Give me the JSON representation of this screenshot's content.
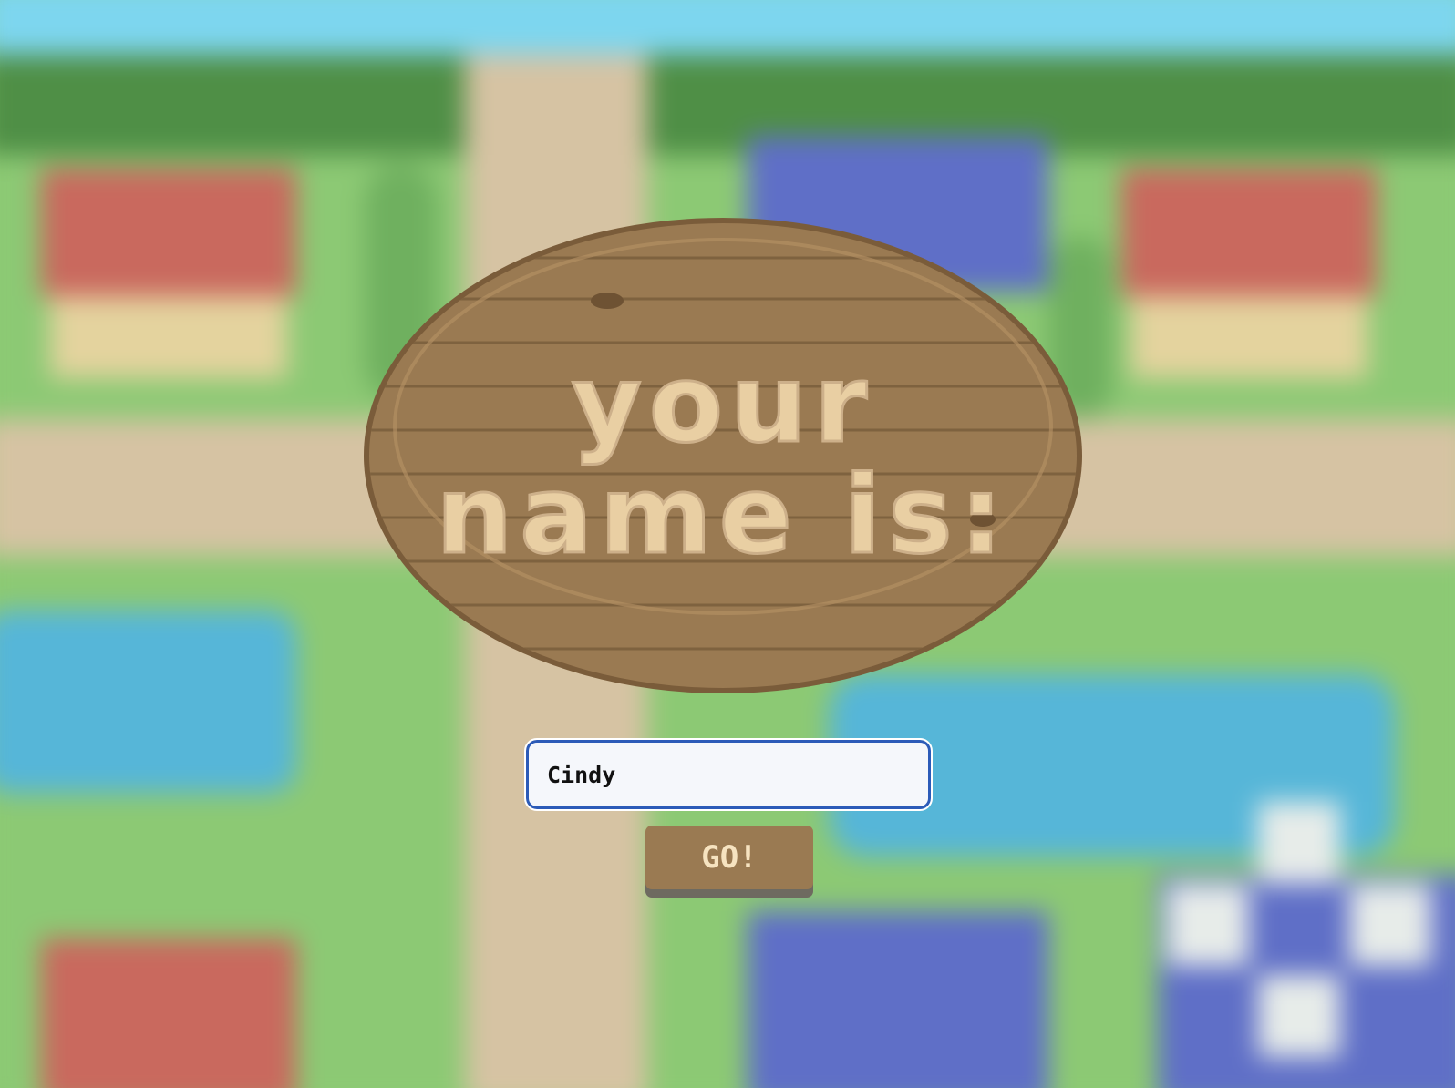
{
  "sign": {
    "line1": "your",
    "line2": "name is:"
  },
  "form": {
    "name_value": "Cindy",
    "go_label": "GO!"
  },
  "colors": {
    "sky": "#7dd6ef",
    "grass": "#8cc974",
    "path": "#d6c3a3",
    "water": "#56b6d8",
    "red_roof": "#c9695e",
    "blue_roof": "#5f6fc7",
    "sign_wood": "#9a7a52",
    "sign_text": "#e9cfa3",
    "input_border": "#2c5bb8"
  }
}
